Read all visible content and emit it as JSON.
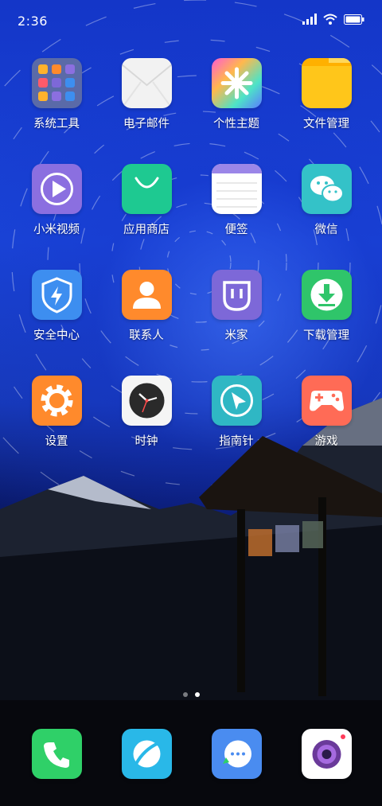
{
  "status_bar": {
    "time": "2:36",
    "icons": [
      "signal-icon",
      "wifi-icon",
      "battery-icon"
    ]
  },
  "home_apps": [
    {
      "label": "系统工具",
      "icon": "folder-icon"
    },
    {
      "label": "电子邮件",
      "icon": "envelope-icon"
    },
    {
      "label": "个性主题",
      "icon": "theme-flower-icon"
    },
    {
      "label": "文件管理",
      "icon": "file-folder-icon"
    },
    {
      "label": "小米视频",
      "icon": "play-icon"
    },
    {
      "label": "应用商店",
      "icon": "shopping-bag-icon"
    },
    {
      "label": "便签",
      "icon": "notepad-icon"
    },
    {
      "label": "微信",
      "icon": "wechat-icon"
    },
    {
      "label": "安全中心",
      "icon": "shield-icon"
    },
    {
      "label": "联系人",
      "icon": "person-icon"
    },
    {
      "label": "米家",
      "icon": "mijia-icon"
    },
    {
      "label": "下载管理",
      "icon": "download-icon"
    },
    {
      "label": "设置",
      "icon": "gear-icon"
    },
    {
      "label": "时钟",
      "icon": "clock-icon"
    },
    {
      "label": "指南针",
      "icon": "compass-icon"
    },
    {
      "label": "游戏",
      "icon": "gamepad-icon"
    }
  ],
  "page_indicator": {
    "pages": 2,
    "current": 2
  },
  "dock": [
    {
      "icon": "phone-icon"
    },
    {
      "icon": "browser-icon"
    },
    {
      "icon": "messages-icon"
    },
    {
      "icon": "camera-icon"
    }
  ],
  "colors": {
    "folder_bg": "#5a6aa8",
    "email_bg": "#f2f2f2",
    "file_bg": "#ffc61a",
    "video_bg": "#8b6fe0",
    "store_bg": "#1ec991",
    "notes_bg": "#ffffff",
    "wechat_bg": "#34c2c8",
    "security_bg": "#3d8ef0",
    "contacts_bg": "#ff8a2c",
    "mijia_bg": "#7d68d8",
    "download_bg": "#2fc56a",
    "settings_bg": "#ff8a2c",
    "clock_bg": "#f5f5f5",
    "compass_bg": "#2fb7c4",
    "game_bg": "#ff6b56",
    "phone_bg": "#2fd068",
    "browser_bg": "#29b8e8",
    "messages_bg": "#4a8cf0",
    "camera_bg": "#ffffff"
  }
}
